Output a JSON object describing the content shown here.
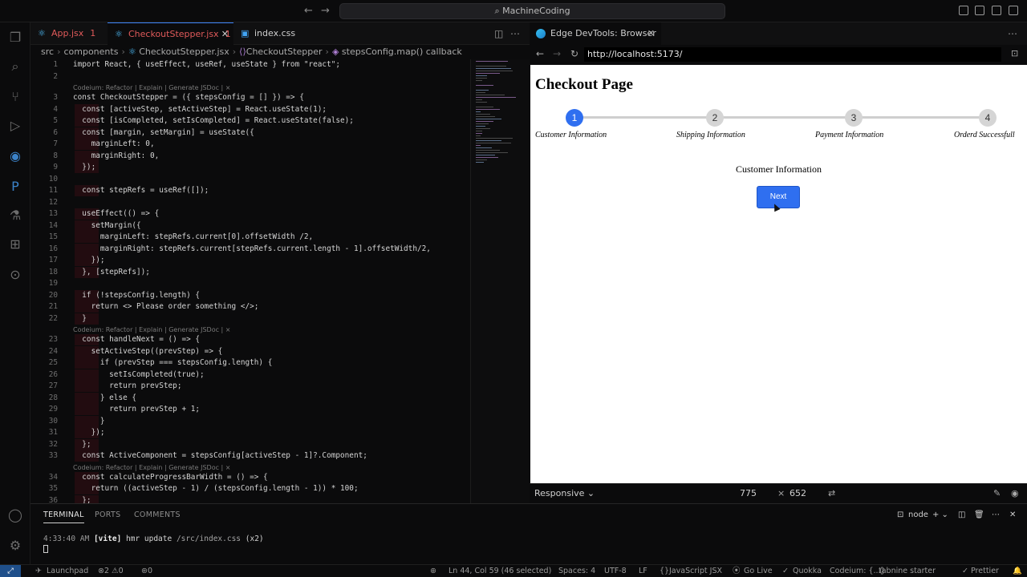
{
  "window": {
    "search_text": "MachineCoding"
  },
  "editor": {
    "tabs": [
      {
        "label": "App.jsx",
        "problems": "1",
        "active": false
      },
      {
        "label": "CheckoutStepper.jsx",
        "problems": "1",
        "active": true
      },
      {
        "label": "index.css",
        "problems": "",
        "active": false
      }
    ],
    "breadcrumb": [
      "src",
      "components",
      "CheckoutStepper.jsx",
      "CheckoutStepper",
      "stepsConfig.map() callback"
    ],
    "codelens": "Codeium: Refactor | Explain | Generate JSDoc | ×",
    "lines": [
      {
        "n": "1",
        "t": "import React, { useEffect, useRef, useState } from \"react\";"
      },
      {
        "n": "2",
        "t": ""
      },
      {
        "n": "3",
        "t": "const CheckoutStepper = ({ stepsConfig = [] }) => {"
      },
      {
        "n": "4",
        "t": "  const [activeStep, setActiveStep] = React.useState(1);"
      },
      {
        "n": "5",
        "t": "  const [isCompleted, setIsCompleted] = React.useState(false);"
      },
      {
        "n": "6",
        "t": "  const [margin, setMargin] = useState({"
      },
      {
        "n": "7",
        "t": "    marginLeft: 0,"
      },
      {
        "n": "8",
        "t": "    marginRight: 0,"
      },
      {
        "n": "9",
        "t": "  });"
      },
      {
        "n": "10",
        "t": ""
      },
      {
        "n": "11",
        "t": "  const stepRefs = useRef([]);"
      },
      {
        "n": "12",
        "t": ""
      },
      {
        "n": "13",
        "t": "  useEffect(() => {"
      },
      {
        "n": "14",
        "t": "    setMargin({"
      },
      {
        "n": "15",
        "t": "      marginLeft: stepRefs.current[0].offsetWidth /2,"
      },
      {
        "n": "16",
        "t": "      marginRight: stepRefs.current[stepRefs.current.length - 1].offsetWidth/2,"
      },
      {
        "n": "17",
        "t": "    });"
      },
      {
        "n": "18",
        "t": "  }, [stepRefs]);"
      },
      {
        "n": "19",
        "t": ""
      },
      {
        "n": "20",
        "t": "  if (!stepsConfig.length) {"
      },
      {
        "n": "21",
        "t": "    return <> Please order something </>;"
      },
      {
        "n": "22",
        "t": "  }"
      },
      {
        "n": "23",
        "t": "  const handleNext = () => {"
      },
      {
        "n": "24",
        "t": "    setActiveStep((prevStep) => {"
      },
      {
        "n": "25",
        "t": "      if (prevStep === stepsConfig.length) {"
      },
      {
        "n": "26",
        "t": "        setIsCompleted(true);"
      },
      {
        "n": "27",
        "t": "        return prevStep;"
      },
      {
        "n": "28",
        "t": "      } else {"
      },
      {
        "n": "29",
        "t": "        return prevStep + 1;"
      },
      {
        "n": "30",
        "t": "      }"
      },
      {
        "n": "31",
        "t": "    });"
      },
      {
        "n": "32",
        "t": "  };"
      },
      {
        "n": "33",
        "t": "  const ActiveComponent = stepsConfig[activeStep - 1]?.Component;"
      },
      {
        "n": "34",
        "t": "  const calculateProgressBarWidth = () => {"
      },
      {
        "n": "35",
        "t": "    return ((activeStep - 1) / (stepsConfig.length - 1)) * 100;"
      },
      {
        "n": "36",
        "t": "  };"
      }
    ]
  },
  "browser": {
    "tab_label": "Edge DevTools: Browser",
    "url": "http://localhost:5173/",
    "page_title": "Checkout Page",
    "steps": [
      {
        "num": "1",
        "label": "Customer Information",
        "active": true
      },
      {
        "num": "2",
        "label": "Shipping Information",
        "active": false
      },
      {
        "num": "3",
        "label": "Payment Information",
        "active": false
      },
      {
        "num": "4",
        "label": "Orderd Successfull",
        "active": false
      }
    ],
    "content_label": "Customer Information",
    "next_label": "Next",
    "device_mode": "Responsive",
    "width": "775",
    "height": "652"
  },
  "panel": {
    "tabs": [
      "TERMINAL",
      "PORTS",
      "COMMENTS"
    ],
    "terminal": {
      "time": "4:33:40 AM",
      "tag": "[vite]",
      "msg": "hmr update",
      "file": "/src/index.css",
      "count": "(x2)"
    },
    "shell": "node"
  },
  "status": {
    "launchpad": "Launchpad",
    "errors": "2",
    "warnings": "0",
    "ports": "0",
    "position": "Ln 44, Col 59 (46 selected)",
    "spaces": "Spaces: 4",
    "encoding": "UTF-8",
    "eol": "LF",
    "language": "JavaScript JSX",
    "golive": "Go Live",
    "quokka": "Quokka",
    "codeium": "Codeium: {...}",
    "tabnine": "tabnine starter",
    "prettier": "Prettier"
  }
}
